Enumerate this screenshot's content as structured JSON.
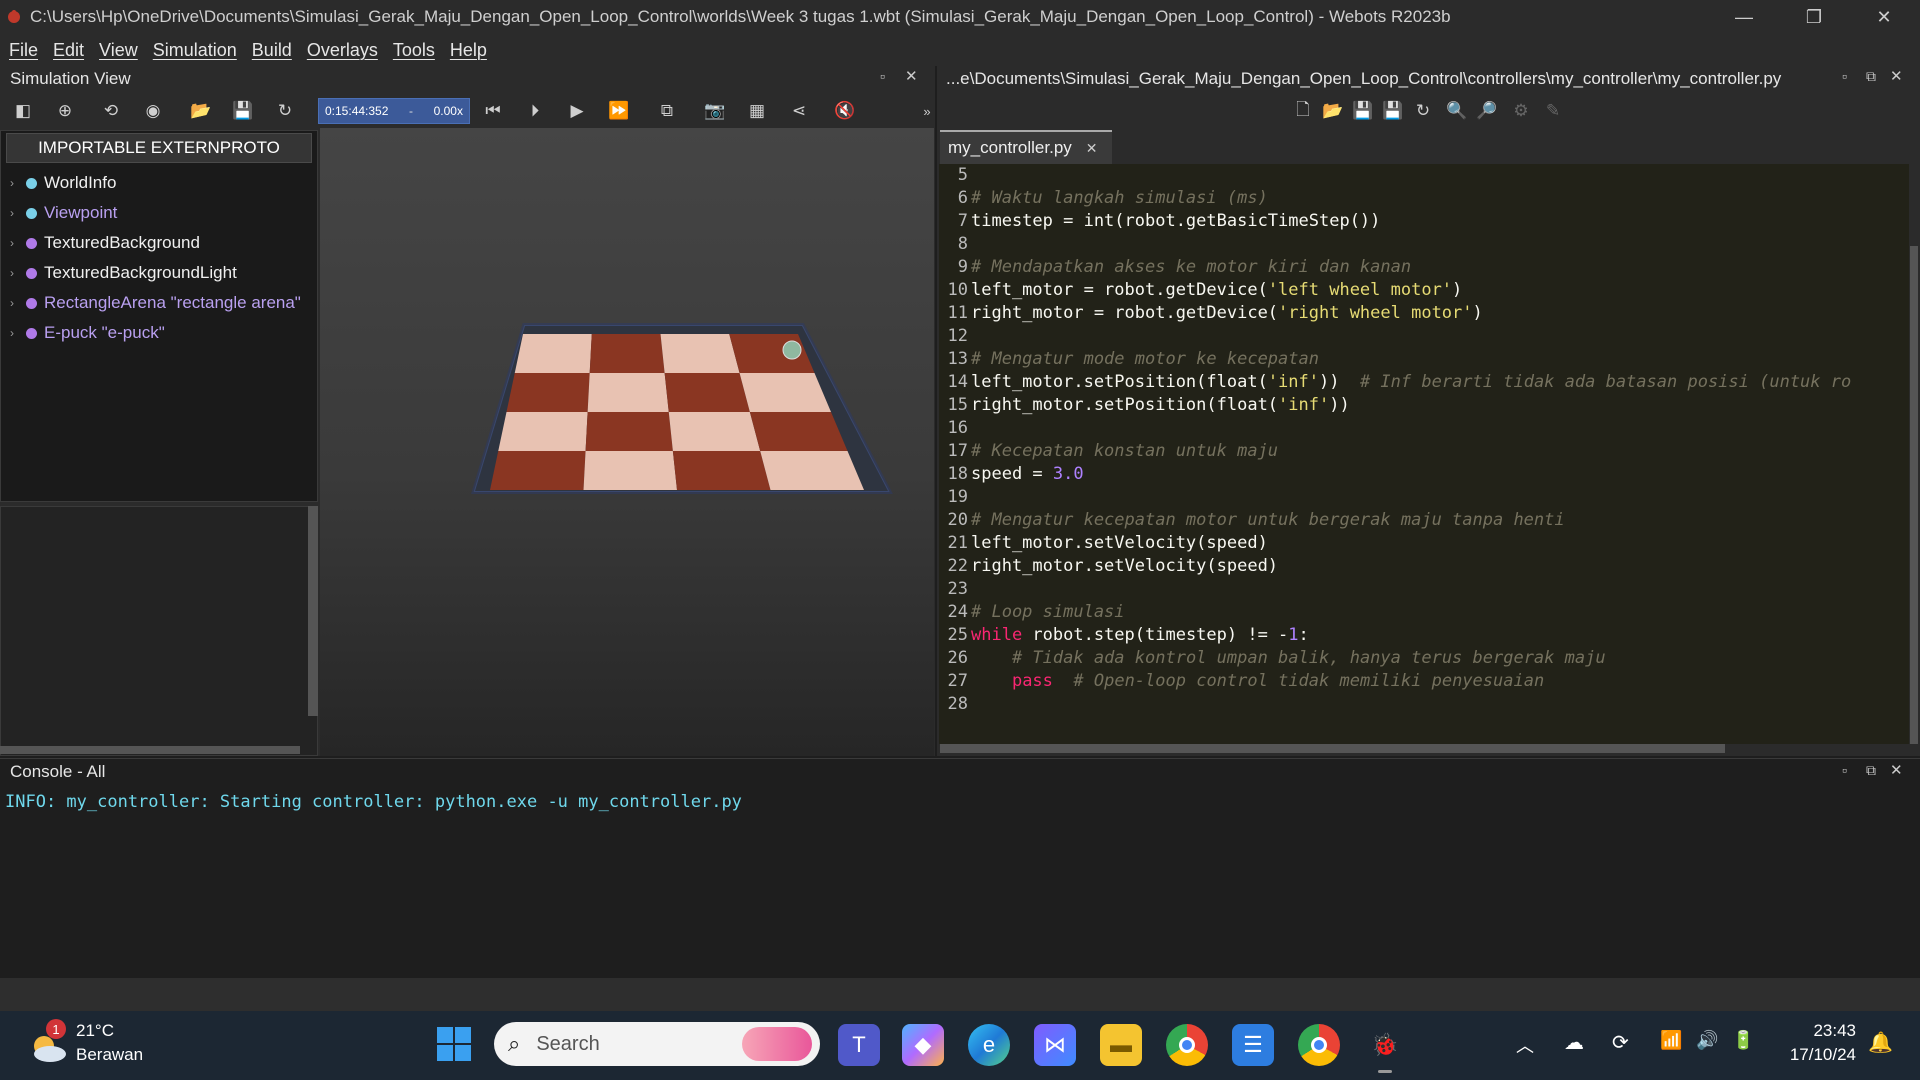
{
  "window": {
    "title": "C:\\Users\\Hp\\OneDrive\\Documents\\Simulasi_Gerak_Maju_Dengan_Open_Loop_Control\\worlds\\Week 3 tugas 1.wbt (Simulasi_Gerak_Maju_Dengan_Open_Loop_Control) - Webots R2023b",
    "min_icon": "minimize-icon",
    "max_icon": "restore-icon",
    "close_icon": "close-icon"
  },
  "menu": [
    "File",
    "Edit",
    "View",
    "Simulation",
    "Build",
    "Overlays",
    "Tools",
    "Help"
  ],
  "sim_view": {
    "title": "Simulation View",
    "time": "0:15:44:352",
    "speed": "0.00x",
    "proto_button": "IMPORTABLE EXTERNPROTO",
    "tree": [
      {
        "label": "WorldInfo",
        "color": "#7ad0e8",
        "text_color": "#f0f0f0"
      },
      {
        "label": "Viewpoint",
        "color": "#7ad0e8",
        "text_color": "#b9a0f0"
      },
      {
        "label": "TexturedBackground",
        "color": "#b07ae8",
        "text_color": "#f0f0f0"
      },
      {
        "label": "TexturedBackgroundLight",
        "color": "#b07ae8",
        "text_color": "#f0f0f0"
      },
      {
        "label": "RectangleArena \"rectangle arena\"",
        "color": "#b07ae8",
        "text_color": "#b9a0f0"
      },
      {
        "label": "E-puck \"e-puck\"",
        "color": "#b07ae8",
        "text_color": "#b9a0f0"
      }
    ]
  },
  "editor": {
    "path": "...e\\Documents\\Simulasi_Gerak_Maju_Dengan_Open_Loop_Control\\controllers\\my_controller\\my_controller.py",
    "tab": "my_controller.py",
    "lines": [
      {
        "n": "5",
        "parts": []
      },
      {
        "n": "6",
        "parts": [
          {
            "c": "cm",
            "t": "# Waktu langkah simulasi (ms)"
          }
        ]
      },
      {
        "n": "7",
        "parts": [
          {
            "c": "tx",
            "t": "timestep = int(robot.getBasicTimeStep())"
          }
        ]
      },
      {
        "n": "8",
        "parts": []
      },
      {
        "n": "9",
        "parts": [
          {
            "c": "cm",
            "t": "# Mendapatkan akses ke motor kiri dan kanan"
          }
        ]
      },
      {
        "n": "10",
        "parts": [
          {
            "c": "tx",
            "t": "left_motor = robot.getDevice("
          },
          {
            "c": "st",
            "t": "'left wheel motor'"
          },
          {
            "c": "tx",
            "t": ")"
          }
        ]
      },
      {
        "n": "11",
        "parts": [
          {
            "c": "tx",
            "t": "right_motor = robot.getDevice("
          },
          {
            "c": "st",
            "t": "'right wheel motor'"
          },
          {
            "c": "tx",
            "t": ")"
          }
        ]
      },
      {
        "n": "12",
        "parts": []
      },
      {
        "n": "13",
        "parts": [
          {
            "c": "cm",
            "t": "# Mengatur mode motor ke kecepatan"
          }
        ]
      },
      {
        "n": "14",
        "parts": [
          {
            "c": "tx",
            "t": "left_motor.setPosition(float("
          },
          {
            "c": "st",
            "t": "'inf'"
          },
          {
            "c": "tx",
            "t": "))  "
          },
          {
            "c": "cm",
            "t": "# Inf berarti tidak ada batasan posisi (untuk ro"
          }
        ]
      },
      {
        "n": "15",
        "parts": [
          {
            "c": "tx",
            "t": "right_motor.setPosition(float("
          },
          {
            "c": "st",
            "t": "'inf'"
          },
          {
            "c": "tx",
            "t": "))"
          }
        ]
      },
      {
        "n": "16",
        "parts": []
      },
      {
        "n": "17",
        "parts": [
          {
            "c": "cm",
            "t": "# Kecepatan konstan untuk maju"
          }
        ]
      },
      {
        "n": "18",
        "parts": [
          {
            "c": "tx",
            "t": "speed = "
          },
          {
            "c": "nu",
            "t": "3.0"
          }
        ]
      },
      {
        "n": "19",
        "parts": []
      },
      {
        "n": "20",
        "parts": [
          {
            "c": "cm",
            "t": "# Mengatur kecepatan motor untuk bergerak maju tanpa henti"
          }
        ]
      },
      {
        "n": "21",
        "parts": [
          {
            "c": "tx",
            "t": "left_motor.setVelocity(speed)"
          }
        ]
      },
      {
        "n": "22",
        "parts": [
          {
            "c": "tx",
            "t": "right_motor.setVelocity(speed)"
          }
        ]
      },
      {
        "n": "23",
        "parts": []
      },
      {
        "n": "24",
        "parts": [
          {
            "c": "cm",
            "t": "# Loop simulasi"
          }
        ]
      },
      {
        "n": "25",
        "parts": [
          {
            "c": "kw",
            "t": "while"
          },
          {
            "c": "tx",
            "t": " robot.step(timestep) != -"
          },
          {
            "c": "nu",
            "t": "1"
          },
          {
            "c": "tx",
            "t": ":"
          }
        ]
      },
      {
        "n": "26",
        "parts": [
          {
            "c": "tx",
            "t": "    "
          },
          {
            "c": "cm",
            "t": "# Tidak ada kontrol umpan balik, hanya terus bergerak maju"
          }
        ]
      },
      {
        "n": "27",
        "parts": [
          {
            "c": "tx",
            "t": "    "
          },
          {
            "c": "kw",
            "t": "pass"
          },
          {
            "c": "tx",
            "t": "  "
          },
          {
            "c": "cm",
            "t": "# Open-loop control tidak memiliki penyesuaian"
          }
        ]
      },
      {
        "n": "28",
        "parts": []
      }
    ]
  },
  "console": {
    "title": "Console - All",
    "line": "INFO: my_controller: Starting controller: python.exe -u my_controller.py"
  },
  "taskbar": {
    "weather_temp": "21°C",
    "weather_desc": "Berawan",
    "weather_badge": "1",
    "search_placeholder": "Search",
    "time": "23:43",
    "date": "17/10/24"
  }
}
